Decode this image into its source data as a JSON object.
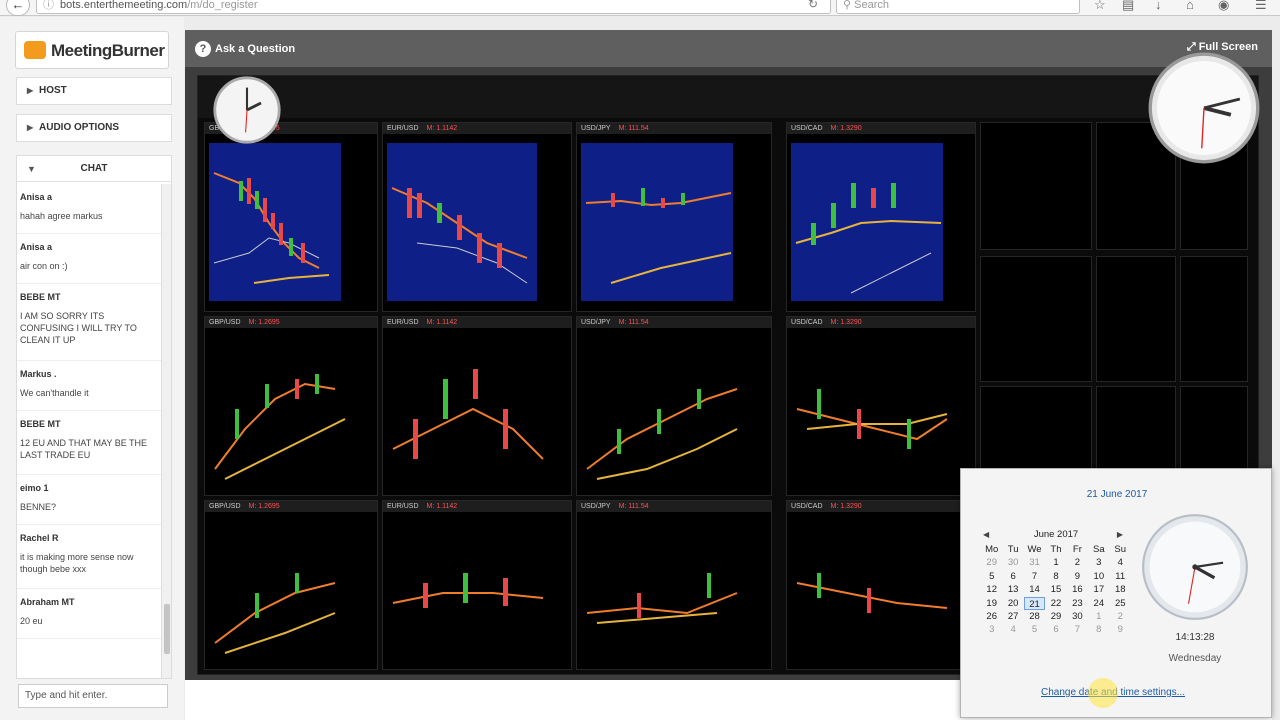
{
  "browser": {
    "url_host": "bots.enterthemeeting.com",
    "url_path": "/m/do_register",
    "search_placeholder": "Search"
  },
  "sidebar": {
    "brand": "MeetingBurner",
    "host_label": "HOST",
    "audio_label": "AUDIO OPTIONS",
    "chat_label": "CHAT",
    "messages": [
      {
        "name": "Anisa a",
        "text": "hahah agree markus"
      },
      {
        "name": "Anisa a",
        "text": "air con on :)"
      },
      {
        "name": "BEBE MT",
        "text": "I AM SO SORRY ITS CONFUSING I WILL TRY TO CLEAN IT UP"
      },
      {
        "name": "Markus .",
        "text": "We can'thandle it"
      },
      {
        "name": "BEBE MT",
        "text": "12 EU AND THAT MAY BE THE LAST TRADE EU"
      },
      {
        "name": "eimo 1",
        "text": "BENNE?"
      },
      {
        "name": "Rachel R",
        "text": "it is making more sense now though bebe xxx"
      },
      {
        "name": "Abraham MT",
        "text": "20 eu"
      }
    ],
    "chat_placeholder": "Type and hit enter."
  },
  "toolbar": {
    "ask_label": "Ask a Question",
    "ask_icon": "?",
    "full_screen_label": "Full Screen"
  },
  "panels": [
    {
      "symbol": "GBP/USD",
      "mark": "M: 1.2695"
    },
    {
      "symbol": "EUR/USD",
      "mark": "M: 1.1142"
    },
    {
      "symbol": "USD/JPY",
      "mark": "M: 111.54"
    },
    {
      "symbol": "USD/CAD",
      "mark": "M: 1.3290"
    }
  ],
  "datetime_popup": {
    "date_heading": "21 June 2017",
    "month_label": "June 2017",
    "weekdays": [
      "Mo",
      "Tu",
      "We",
      "Th",
      "Fr",
      "Sa",
      "Su"
    ],
    "weeks": [
      [
        "29",
        "30",
        "31",
        "1",
        "2",
        "3",
        "4"
      ],
      [
        "5",
        "6",
        "7",
        "8",
        "9",
        "10",
        "11"
      ],
      [
        "12",
        "13",
        "14",
        "15",
        "16",
        "17",
        "18"
      ],
      [
        "19",
        "20",
        "21",
        "22",
        "23",
        "24",
        "25"
      ],
      [
        "26",
        "27",
        "28",
        "29",
        "30",
        "1",
        "2"
      ],
      [
        "3",
        "4",
        "5",
        "6",
        "7",
        "8",
        "9"
      ]
    ],
    "selected_day": "21",
    "time": "14:13:28",
    "weekday": "Wednesday",
    "link": "Change date and time settings..."
  }
}
